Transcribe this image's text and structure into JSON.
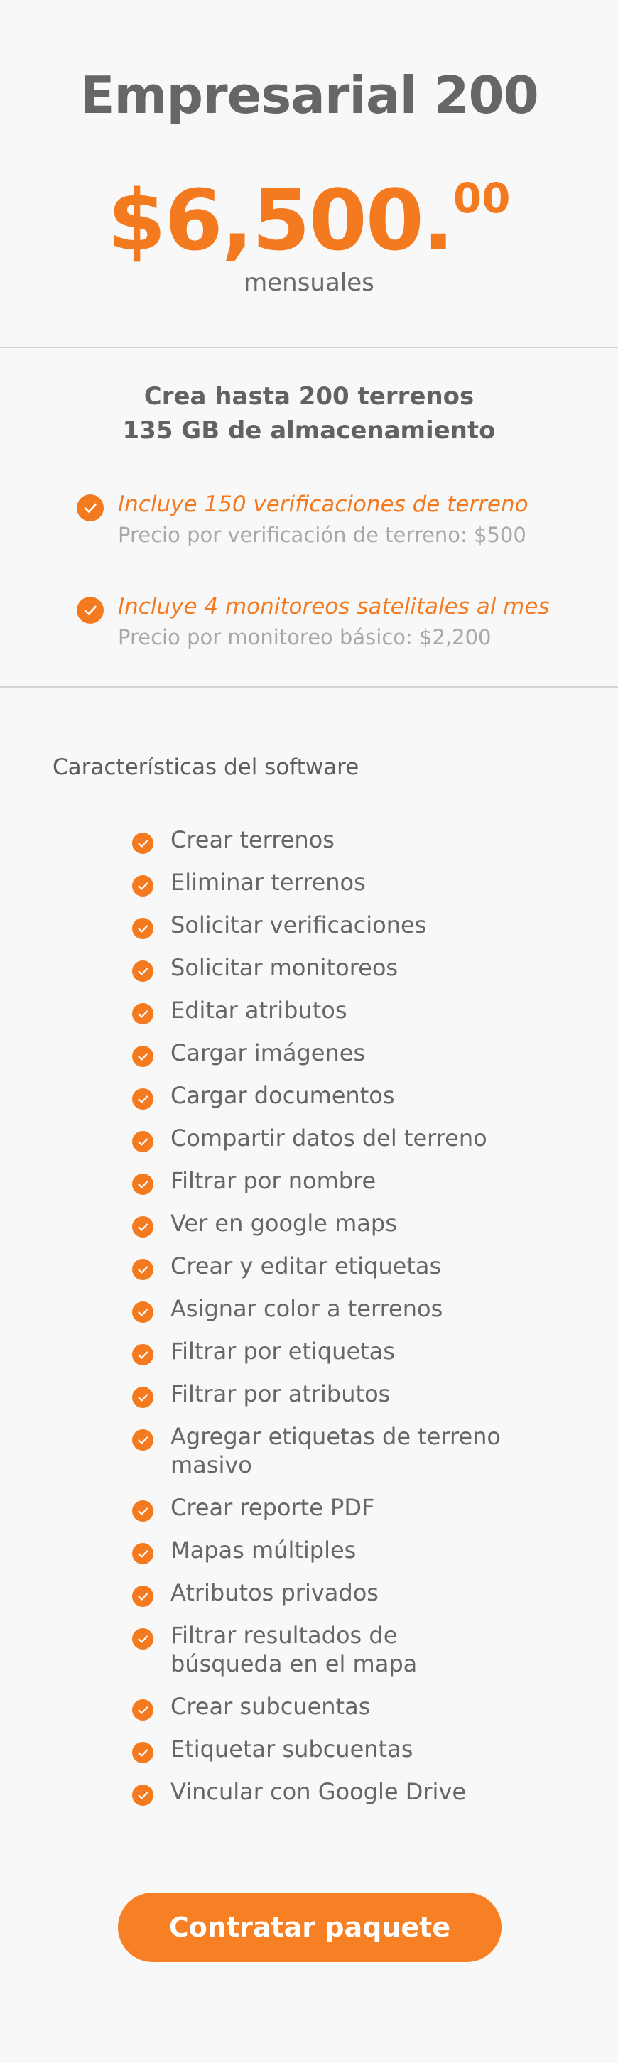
{
  "plan": {
    "name": "Empresarial 200",
    "price_main": "$6,500.",
    "price_cents": "00",
    "period": "mensuales"
  },
  "capacity": {
    "line1": "Crea hasta 200 terrenos",
    "line2": "135 GB de almacenamiento"
  },
  "included": [
    {
      "title": "Incluye 150 verificaciones de terreno",
      "subtitle": "Precio por verificación de terreno: $500"
    },
    {
      "title": "Incluye 4 monitoreos satelitales al mes",
      "subtitle": "Precio por monitoreo básico: $2,200"
    }
  ],
  "features": {
    "title": "Características del software",
    "items": [
      "Crear terrenos",
      "Eliminar terrenos",
      "Solicitar verificaciones",
      "Solicitar monitoreos",
      "Editar atributos",
      "Cargar imágenes",
      "Cargar documentos",
      "Compartir datos del terreno",
      "Filtrar por nombre",
      "Ver en google maps",
      "Crear y editar etiquetas",
      "Asignar color a terrenos",
      "Filtrar por etiquetas",
      "Filtrar por atributos",
      "Agregar etiquetas de terreno masivo",
      "Crear reporte PDF",
      "Mapas múltiples",
      "Atributos privados",
      "Filtrar resultados de búsqueda en el mapa",
      "Crear subcuentas",
      "Etiquetar subcuentas",
      "Vincular con Google Drive"
    ]
  },
  "cta": {
    "label": "Contratar paquete"
  },
  "icons": {
    "check": "check-circle-icon"
  },
  "colors": {
    "accent": "#f47a20",
    "text": "#666666",
    "muted": "#a8a8a8"
  }
}
